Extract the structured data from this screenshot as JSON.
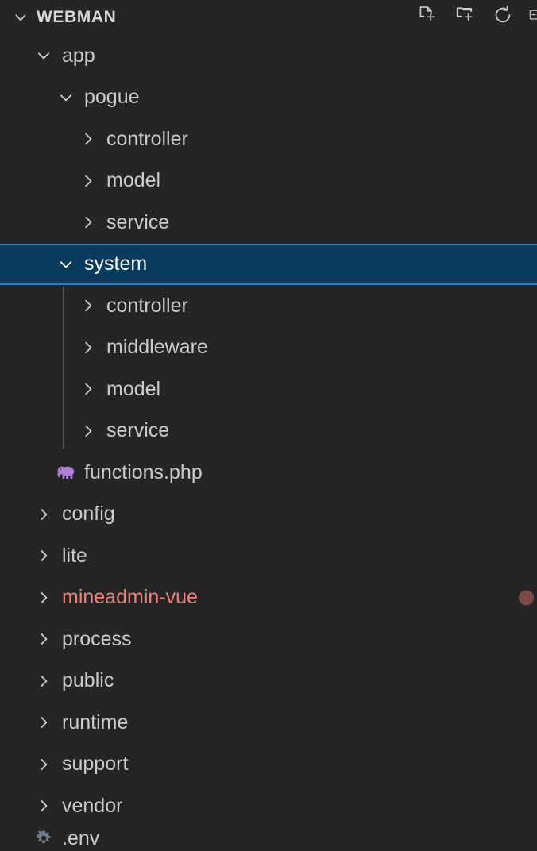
{
  "header": {
    "title": "WEBMAN",
    "twisty_icon": "chevron-down-icon",
    "actions": [
      {
        "name": "new-file-icon",
        "tooltip": "New File"
      },
      {
        "name": "new-folder-icon",
        "tooltip": "New Folder"
      },
      {
        "name": "refresh-icon",
        "tooltip": "Refresh Explorer"
      },
      {
        "name": "collapse-all-icon",
        "tooltip": "Collapse Folders in Explorer"
      }
    ]
  },
  "colors": {
    "background": "#252526",
    "foreground": "#cccccc",
    "selection_background": "#063b5e",
    "selection_border": "#1f7fd0",
    "ignored_foreground": "#e8867e",
    "badge_dot": "#7d4a48",
    "php_icon": "#ad7fd5",
    "gear_icon": "#6d7c87",
    "indent_guide": "#585858"
  },
  "tree": {
    "rows": [
      {
        "label": "app",
        "depth": 1,
        "type": "folder",
        "state": "expanded",
        "selected": false,
        "ignored": false,
        "icon": "chevron-down-icon"
      },
      {
        "label": "pogue",
        "depth": 2,
        "type": "folder",
        "state": "expanded",
        "selected": false,
        "ignored": false,
        "icon": "chevron-down-icon"
      },
      {
        "label": "controller",
        "depth": 3,
        "type": "folder",
        "state": "collapsed",
        "selected": false,
        "ignored": false,
        "icon": "chevron-right-icon"
      },
      {
        "label": "model",
        "depth": 3,
        "type": "folder",
        "state": "collapsed",
        "selected": false,
        "ignored": false,
        "icon": "chevron-right-icon"
      },
      {
        "label": "service",
        "depth": 3,
        "type": "folder",
        "state": "collapsed",
        "selected": false,
        "ignored": false,
        "icon": "chevron-right-icon"
      },
      {
        "label": "system",
        "depth": 2,
        "type": "folder",
        "state": "expanded",
        "selected": true,
        "ignored": false,
        "icon": "chevron-down-icon"
      },
      {
        "label": "controller",
        "depth": 3,
        "type": "folder",
        "state": "collapsed",
        "selected": false,
        "ignored": false,
        "icon": "chevron-right-icon"
      },
      {
        "label": "middleware",
        "depth": 3,
        "type": "folder",
        "state": "collapsed",
        "selected": false,
        "ignored": false,
        "icon": "chevron-right-icon"
      },
      {
        "label": "model",
        "depth": 3,
        "type": "folder",
        "state": "collapsed",
        "selected": false,
        "ignored": false,
        "icon": "chevron-right-icon"
      },
      {
        "label": "service",
        "depth": 3,
        "type": "folder",
        "state": "collapsed",
        "selected": false,
        "ignored": false,
        "icon": "chevron-right-icon"
      },
      {
        "label": "functions.php",
        "depth": 2,
        "type": "file",
        "state": "none",
        "selected": false,
        "ignored": false,
        "icon": "php-elephant-icon"
      },
      {
        "label": "config",
        "depth": 1,
        "type": "folder",
        "state": "collapsed",
        "selected": false,
        "ignored": false,
        "icon": "chevron-right-icon"
      },
      {
        "label": "lite",
        "depth": 1,
        "type": "folder",
        "state": "collapsed",
        "selected": false,
        "ignored": false,
        "icon": "chevron-right-icon"
      },
      {
        "label": "mineadmin-vue",
        "depth": 1,
        "type": "folder",
        "state": "collapsed",
        "selected": false,
        "ignored": true,
        "icon": "chevron-right-icon",
        "badge": true
      },
      {
        "label": "process",
        "depth": 1,
        "type": "folder",
        "state": "collapsed",
        "selected": false,
        "ignored": false,
        "icon": "chevron-right-icon"
      },
      {
        "label": "public",
        "depth": 1,
        "type": "folder",
        "state": "collapsed",
        "selected": false,
        "ignored": false,
        "icon": "chevron-right-icon"
      },
      {
        "label": "runtime",
        "depth": 1,
        "type": "folder",
        "state": "collapsed",
        "selected": false,
        "ignored": false,
        "icon": "chevron-right-icon"
      },
      {
        "label": "support",
        "depth": 1,
        "type": "folder",
        "state": "collapsed",
        "selected": false,
        "ignored": false,
        "icon": "chevron-right-icon"
      },
      {
        "label": "vendor",
        "depth": 1,
        "type": "folder",
        "state": "collapsed",
        "selected": false,
        "ignored": false,
        "icon": "chevron-right-icon"
      },
      {
        "label": ".env",
        "depth": 1,
        "type": "file",
        "state": "none",
        "selected": false,
        "ignored": false,
        "icon": "gear-icon",
        "clipped": true
      }
    ]
  }
}
